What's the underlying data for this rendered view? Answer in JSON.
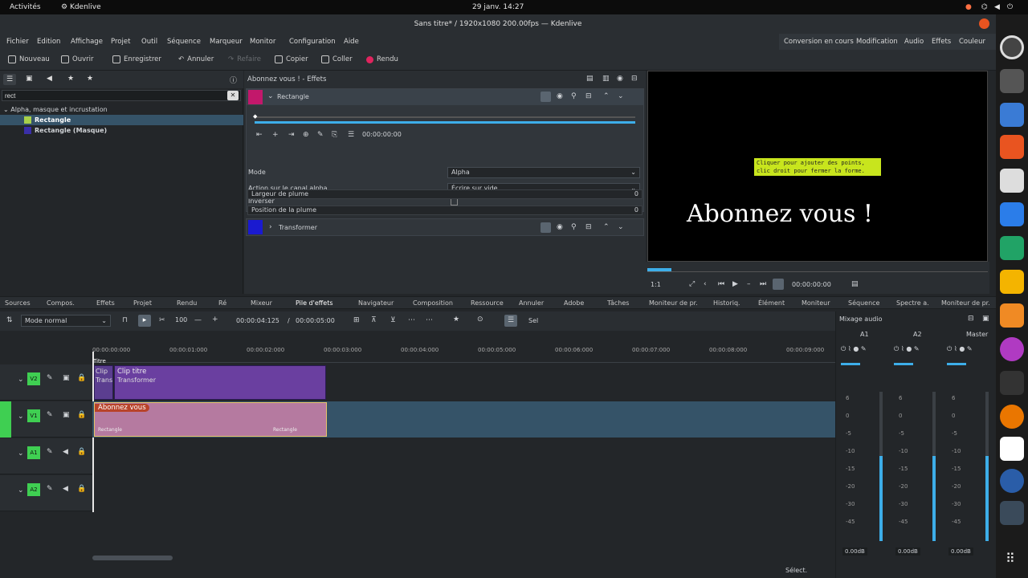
{
  "topbar": {
    "activities": "Activités",
    "app_name": "Kdenlive",
    "clock": "29 janv. 14:27"
  },
  "window": {
    "title": "Sans titre* / 1920x1080 200.00fps — Kdenlive"
  },
  "menu": {
    "items": [
      "Fichier",
      "Edition",
      "Affichage",
      "Projet",
      "Outil",
      "Séquence",
      "Marqueur",
      "Monitor",
      "Configuration",
      "Aide"
    ],
    "layouts": [
      "Conversion en cours",
      "Modification",
      "Audio",
      "Effets",
      "Couleur"
    ]
  },
  "toolbar": {
    "new": "Nouveau",
    "open": "Ouvrir",
    "save": "Enregistrer",
    "undo": "Annuler",
    "redo": "Refaire",
    "copy": "Copier",
    "paste": "Coller",
    "render": "Rendu"
  },
  "library": {
    "search_value": "rect",
    "category": "Alpha, masque et incrustation",
    "items": [
      "Rectangle",
      "Rectangle (Masque)"
    ]
  },
  "effects": {
    "header": "Abonnez vous ! - Effets",
    "effect1": "Rectangle",
    "timecode": "00:00:00:00",
    "params": [
      {
        "label": "Mode",
        "value": "Alpha"
      },
      {
        "label": "Action sur le canal alpha",
        "value": "Écrire sur vide"
      },
      {
        "label": "Inverser",
        "value": ""
      }
    ],
    "slider1": "Largeur de plume",
    "slider1_value": "0",
    "slider2": "Position de la plume",
    "slider2_value": "0",
    "effect2": "Transformer"
  },
  "monitor": {
    "caption_line1": "Cliquer pour ajouter des points,",
    "caption_line2": "clic droit pour fermer la forme.",
    "overlay_text": "Abonnez vous !",
    "zoom": "1:1",
    "timecode": "00:00:00:00"
  },
  "dock_tabs": [
    "Sources",
    "Compos.",
    "Effets",
    "Projet",
    "Rendu",
    "Ré",
    "Mixeur",
    "Pile d'effets",
    "Navigateur",
    "Composition",
    "Ressource",
    "Annuler",
    "Adobe",
    "Tâches",
    "Moniteur de pr.",
    "Historiq.",
    "Élément",
    "Moniteur",
    "Séquence",
    "Spectre a.",
    "Moniteur de pr."
  ],
  "timeline_toolbar": {
    "mode": "Mode normal",
    "zoom": "100",
    "position": "00:00:04:125",
    "duration": "00:00:05:00",
    "label": "Sel"
  },
  "ruler": [
    "00:00:00:000",
    "00:00:01:000",
    "00:00:02:000",
    "00:00:03:000",
    "00:00:04:000",
    "00:00:05:000",
    "00:00:06:000",
    "00:00:07:000",
    "00:00:08:000",
    "00:00:09:000"
  ],
  "tracks": [
    {
      "name": "V2",
      "clips": [
        {
          "label": "Clip titre",
          "sub": "Transformer"
        },
        {
          "label": "Clip",
          "sub": "Trans"
        }
      ]
    },
    {
      "name": "V1",
      "clips": [
        {
          "label": "Abonnez vous",
          "sub": "Rectangle",
          "sub2": "Rectangle"
        }
      ]
    },
    {
      "name": "A1",
      "clips": []
    },
    {
      "name": "A2",
      "clips": []
    }
  ],
  "playhead_label": "Titre",
  "mixer": {
    "title": "Mixage audio",
    "channels": [
      "A1",
      "A2",
      "Master"
    ],
    "db": [
      "6",
      "0",
      "-5",
      "-10",
      "-15",
      "-20",
      "-30",
      "-45"
    ],
    "values": [
      "0.00dB",
      "0.00dB",
      "0.00dB"
    ]
  },
  "statusbar": {
    "select": "Sélect."
  },
  "colors": {
    "accent": "#3daee9",
    "clip_title": "#6a3fa0",
    "clip_video": "#b57aa0",
    "selection": "#355368"
  }
}
